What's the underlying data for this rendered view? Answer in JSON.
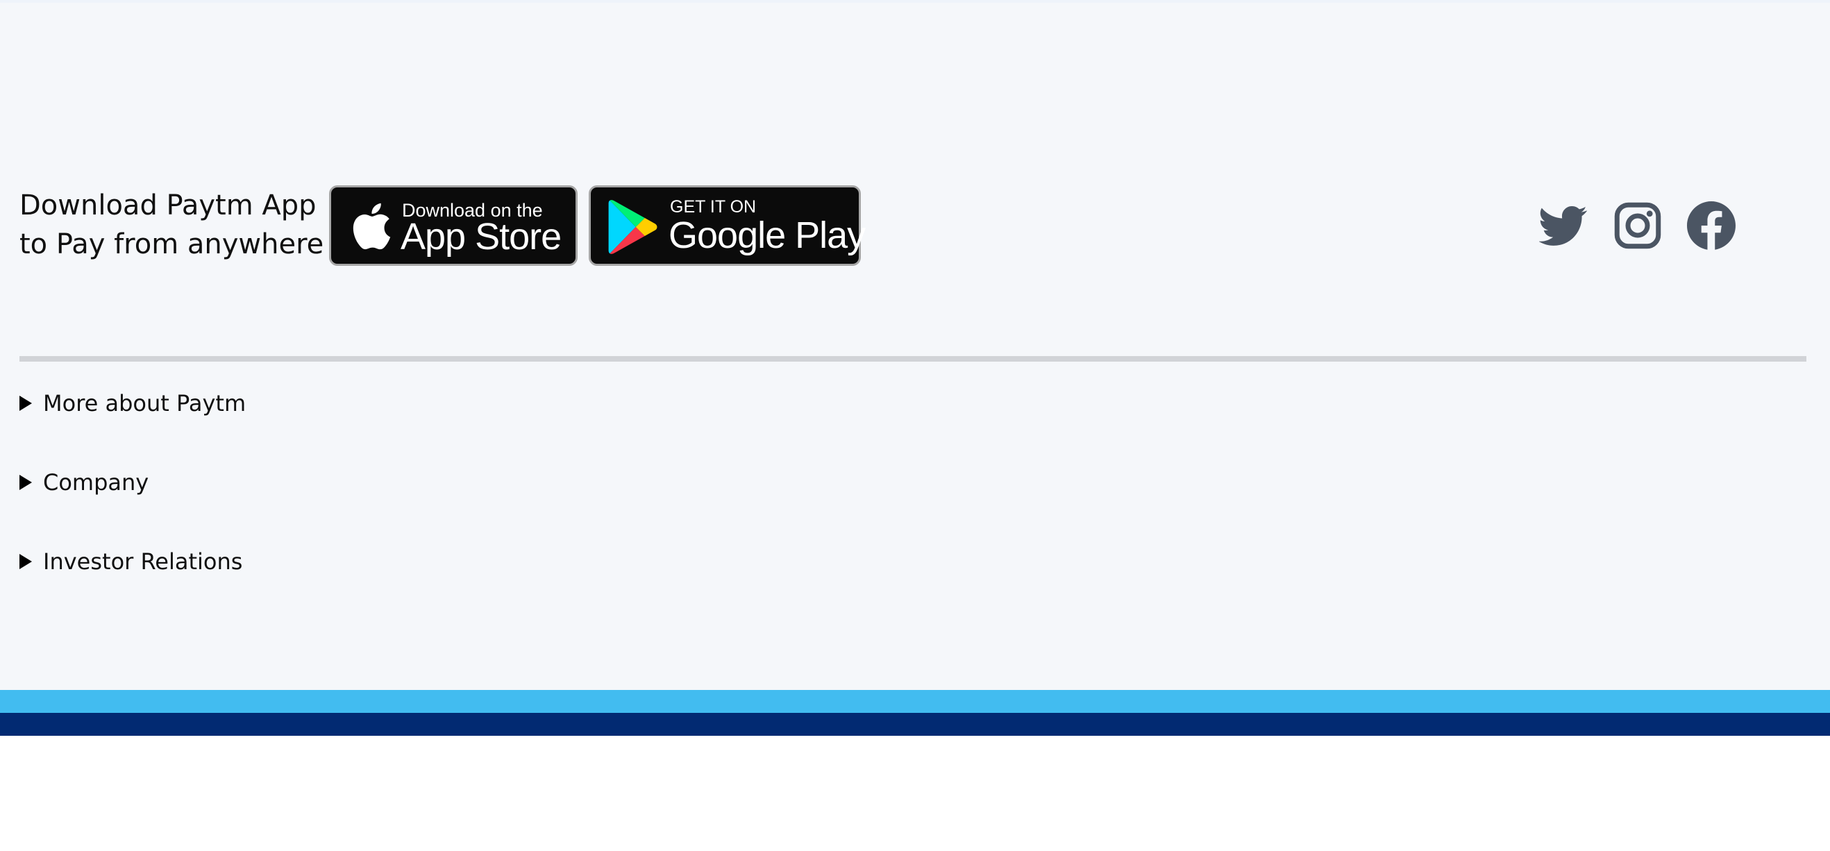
{
  "download": {
    "line1": "Download Paytm App",
    "line2": "to Pay from anywhere"
  },
  "badges": {
    "appstore": {
      "small": "Download on the",
      "big": "App Store",
      "icon": "apple-icon"
    },
    "googleplay": {
      "small": "GET IT ON",
      "big": "Google Play",
      "icon": "google-play-icon"
    }
  },
  "social": [
    {
      "name": "twitter",
      "icon": "twitter-icon"
    },
    {
      "name": "instagram",
      "icon": "instagram-icon"
    },
    {
      "name": "facebook",
      "icon": "facebook-icon"
    }
  ],
  "accordion": [
    {
      "label": "More about Paytm"
    },
    {
      "label": "Company"
    },
    {
      "label": "Investor Relations"
    }
  ],
  "colors": {
    "footer_bg": "#f5f7fa",
    "social_icon": "#4b5563",
    "band_light": "#42bcf0",
    "band_dark": "#022a72",
    "divider": "#d1d3d7"
  }
}
